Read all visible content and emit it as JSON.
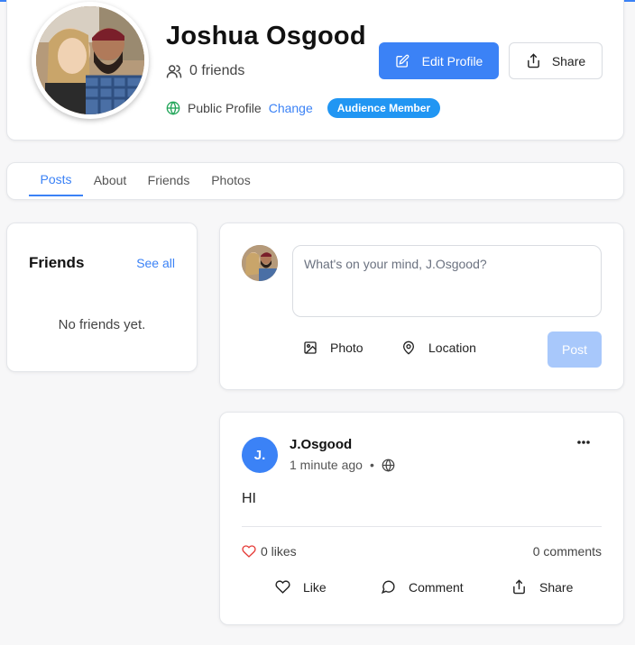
{
  "profile": {
    "name": "Joshua Osgood",
    "friends_count": "0 friends",
    "visibility": "Public Profile",
    "change_label": "Change",
    "role_badge": "Audience Member",
    "edit_label": "Edit Profile",
    "share_label": "Share"
  },
  "tabs": [
    {
      "label": "Posts",
      "active": true
    },
    {
      "label": "About"
    },
    {
      "label": "Friends"
    },
    {
      "label": "Photos"
    }
  ],
  "friends_widget": {
    "title": "Friends",
    "see_all": "See all",
    "empty_text": "No friends yet."
  },
  "composer": {
    "placeholder": "What's on your mind, J.Osgood?",
    "photo_label": "Photo",
    "location_label": "Location",
    "post_label": "Post"
  },
  "post": {
    "avatar_initials": "J.",
    "author": "J.Osgood",
    "time": "1 minute ago",
    "separator": "•",
    "body": "HI",
    "likes": "0 likes",
    "comments": "0 comments",
    "like_label": "Like",
    "comment_label": "Comment",
    "share_label": "Share"
  },
  "colors": {
    "accent": "#3b82f6",
    "badge": "#2196f3",
    "post_disabled": "#a8c8fb",
    "like_heart": "#e53935",
    "globe_public": "#22a559"
  }
}
